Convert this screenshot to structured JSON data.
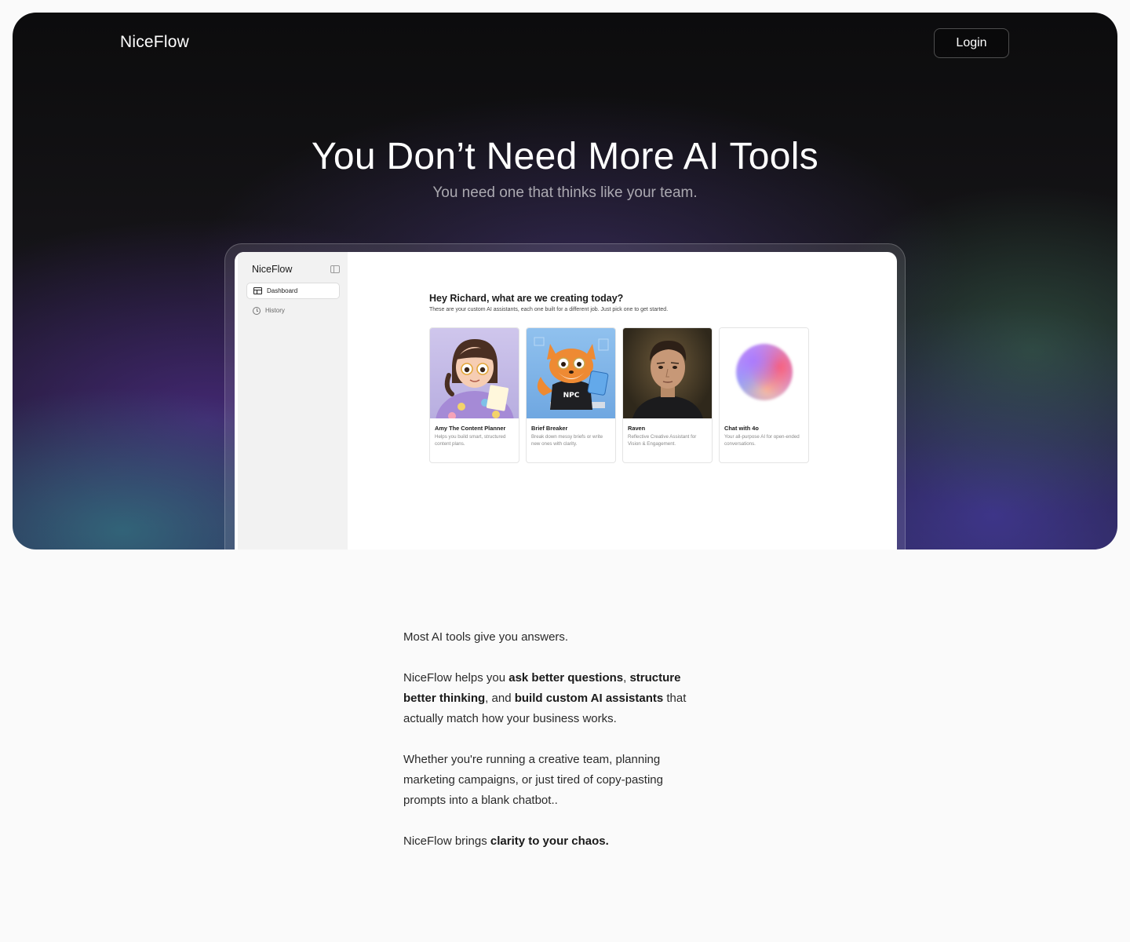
{
  "header": {
    "brand": "NiceFlow",
    "login_label": "Login"
  },
  "hero": {
    "title": "You Don’t Need More AI Tools",
    "subtitle": "You need one that thinks like your team."
  },
  "app_preview": {
    "sidebar": {
      "brand": "NiceFlow",
      "items": [
        {
          "label": "Dashboard",
          "icon": "dashboard-icon",
          "active": true
        },
        {
          "label": "History",
          "icon": "history-icon",
          "active": false
        }
      ]
    },
    "greeting": "Hey Richard, what are we creating today?",
    "greeting_sub": "These are your custom AI assistants, each one built for a different job. Just pick one to get started.",
    "assistants": [
      {
        "name": "Amy The Content Planner",
        "description": "Helps you build smart, structured content plans."
      },
      {
        "name": "Brief Breaker",
        "description": "Break down messy briefs or write new ones with clarity."
      },
      {
        "name": "Raven",
        "description": "Reflective Creative Assistant for Vision & Engagement."
      },
      {
        "name": "Chat with 4o",
        "description": "Your all-purpose AI for open-ended conversations."
      }
    ],
    "fox_shirt_text": "NPC"
  },
  "content": {
    "p1": "Most AI tools give you answers.",
    "p2": {
      "a": "NiceFlow helps you ",
      "b1": "ask better questions",
      "c": ", ",
      "b2": "structure better thinking",
      "d": ", and ",
      "b3": "build custom AI assistants",
      "e": " that actually match how your business works."
    },
    "p3": "Whether you're running a creative team, planning marketing campaigns, or just tired of copy-pasting prompts into a blank chatbot..",
    "p4": {
      "a": "NiceFlow brings ",
      "b": "clarity to your chaos."
    }
  },
  "colors": {
    "hero_bg": "#111113",
    "page_bg": "#fafafa",
    "accent_purple": "#4b3c9a",
    "accent_teal": "#2f7a80"
  }
}
